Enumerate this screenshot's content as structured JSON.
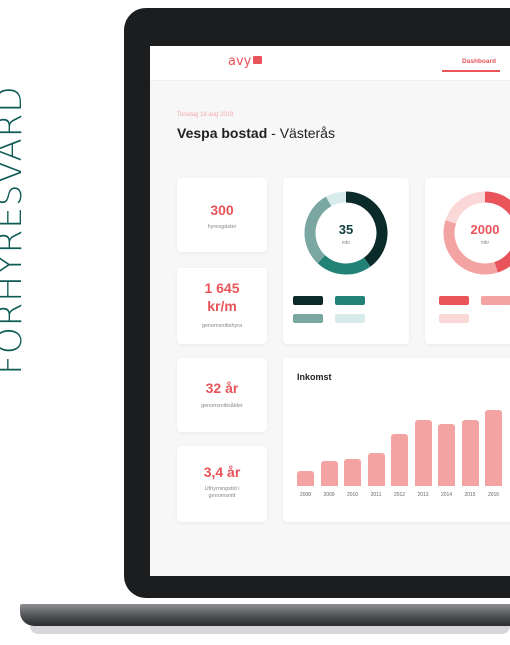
{
  "side_title": "FÖRHYRESVÄRD",
  "app": {
    "logo": "avy",
    "nav_tab": "Dashboard"
  },
  "header": {
    "date": "Torsdag 18 aug 2019",
    "title_bold": "Vespa bostad",
    "title_rest": " - Västerås"
  },
  "stats": [
    {
      "value": "300",
      "label": "hyresgäster"
    },
    {
      "value": "1 645\nkr/m",
      "value_line1": "1 645",
      "value_line2": "kr/m",
      "label": "genomsnittshyra"
    },
    {
      "value": "32 år",
      "label": "genomsnittsålder"
    },
    {
      "value": "3,4 år",
      "label_line1": "Uthyrningstid i",
      "label_line2": "genomsnitt"
    }
  ],
  "donut1": {
    "value": "35",
    "unit": "mkr",
    "colors": [
      "#0b2b2a",
      "#238276",
      "#7aa7a2",
      "#d7ebeb"
    ],
    "segments": [
      0.4,
      0.22,
      0.3,
      0.08
    ]
  },
  "donut2": {
    "value": "2000",
    "unit": "mkr",
    "colors": [
      "#e9545a",
      "#f4a3a3",
      "#fbd8d8"
    ],
    "segments": [
      0.45,
      0.35,
      0.2
    ]
  },
  "chart_data": {
    "type": "bar",
    "title": "Inkomst",
    "categories": [
      "2008",
      "2009",
      "2010",
      "2011",
      "2012",
      "2013",
      "2014",
      "2015",
      "2016"
    ],
    "values": [
      12,
      20,
      22,
      27,
      42,
      54,
      50,
      54,
      62
    ],
    "color": "#f4a3a3"
  }
}
